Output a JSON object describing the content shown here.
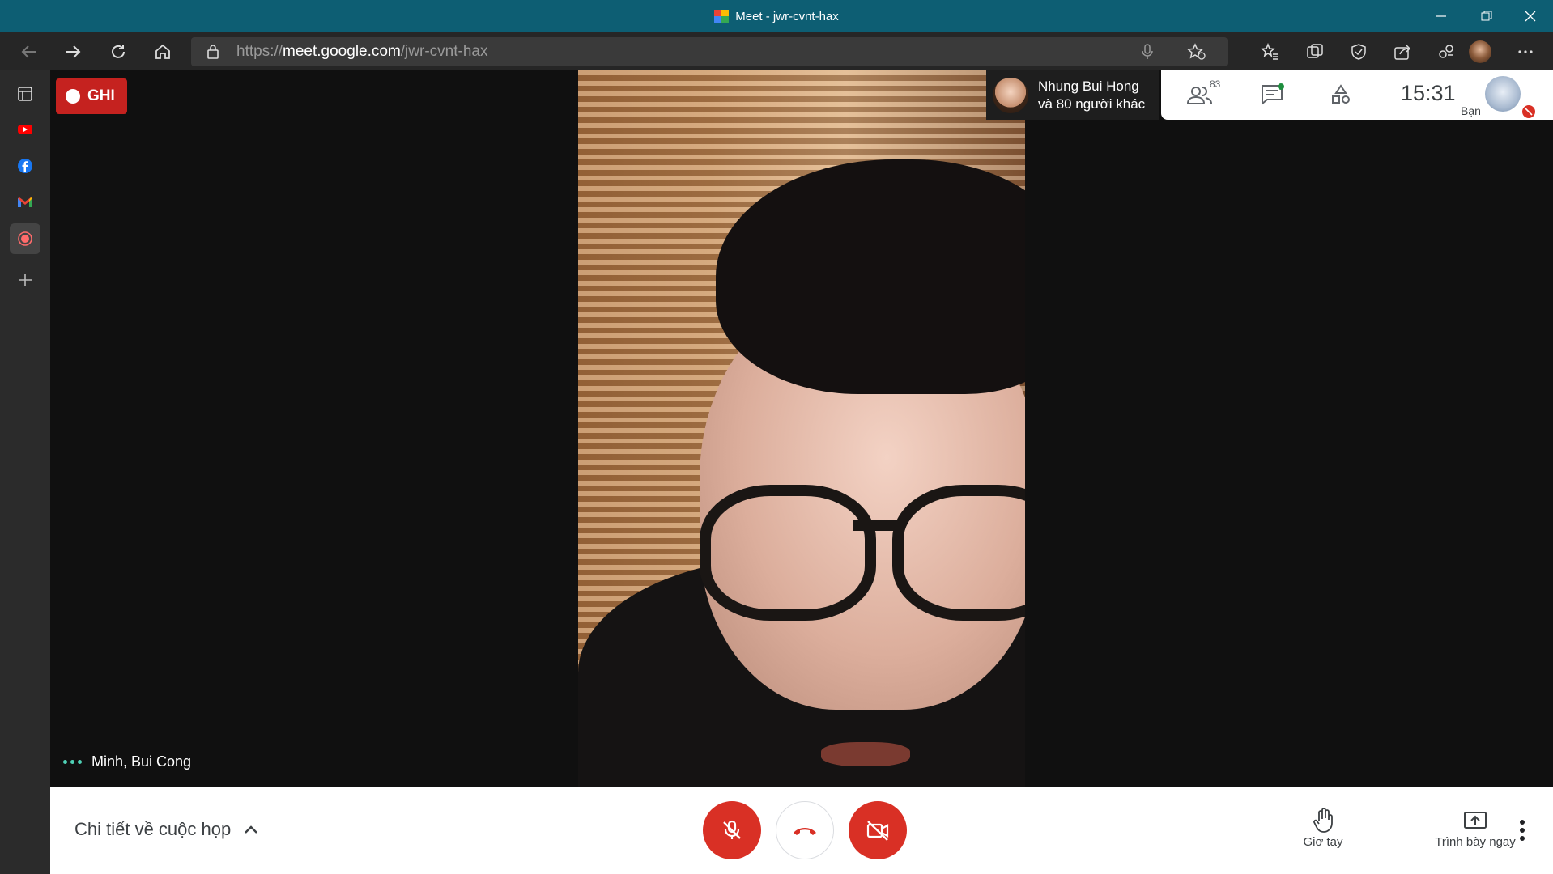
{
  "window": {
    "title": "Meet - jwr-cvnt-hax",
    "controls": [
      "minimize",
      "restore",
      "close"
    ]
  },
  "browser": {
    "url_scheme": "https://",
    "url_host": "meet.google.com",
    "url_path": "/jwr-cvnt-hax",
    "nav_icons": [
      "back-icon",
      "forward-icon",
      "refresh-icon",
      "home-icon"
    ],
    "toolbar_icons": [
      "mic-icon",
      "add-favorite-icon",
      "favorites-icon",
      "collections-icon",
      "browser-essentials-icon",
      "share-icon",
      "extensions-icon",
      "profile-avatar",
      "more-icon"
    ]
  },
  "sidebar": {
    "items": [
      {
        "name": "tab-icon"
      },
      {
        "name": "youtube-icon"
      },
      {
        "name": "facebook-icon"
      },
      {
        "name": "gmail-icon"
      },
      {
        "name": "record-icon",
        "active": true
      },
      {
        "name": "add-icon"
      }
    ]
  },
  "meeting": {
    "recording_label": "GHI",
    "speaker_name": "Minh, Bui Cong",
    "others_line1": "Nhung Bui Hong",
    "others_line2": "và 80 người khác",
    "participant_count": "83",
    "clock": "15:31",
    "you_label": "Bạn",
    "details_label": "Chi tiết về cuộc họp",
    "raise_hand_label": "Giơ tay",
    "present_label": "Trình bày ngay"
  },
  "colors": {
    "titlebar": "#0d5e73",
    "record_red": "#c5221f",
    "control_red": "#d93025",
    "speaking_dots": "#4fd1b6"
  }
}
